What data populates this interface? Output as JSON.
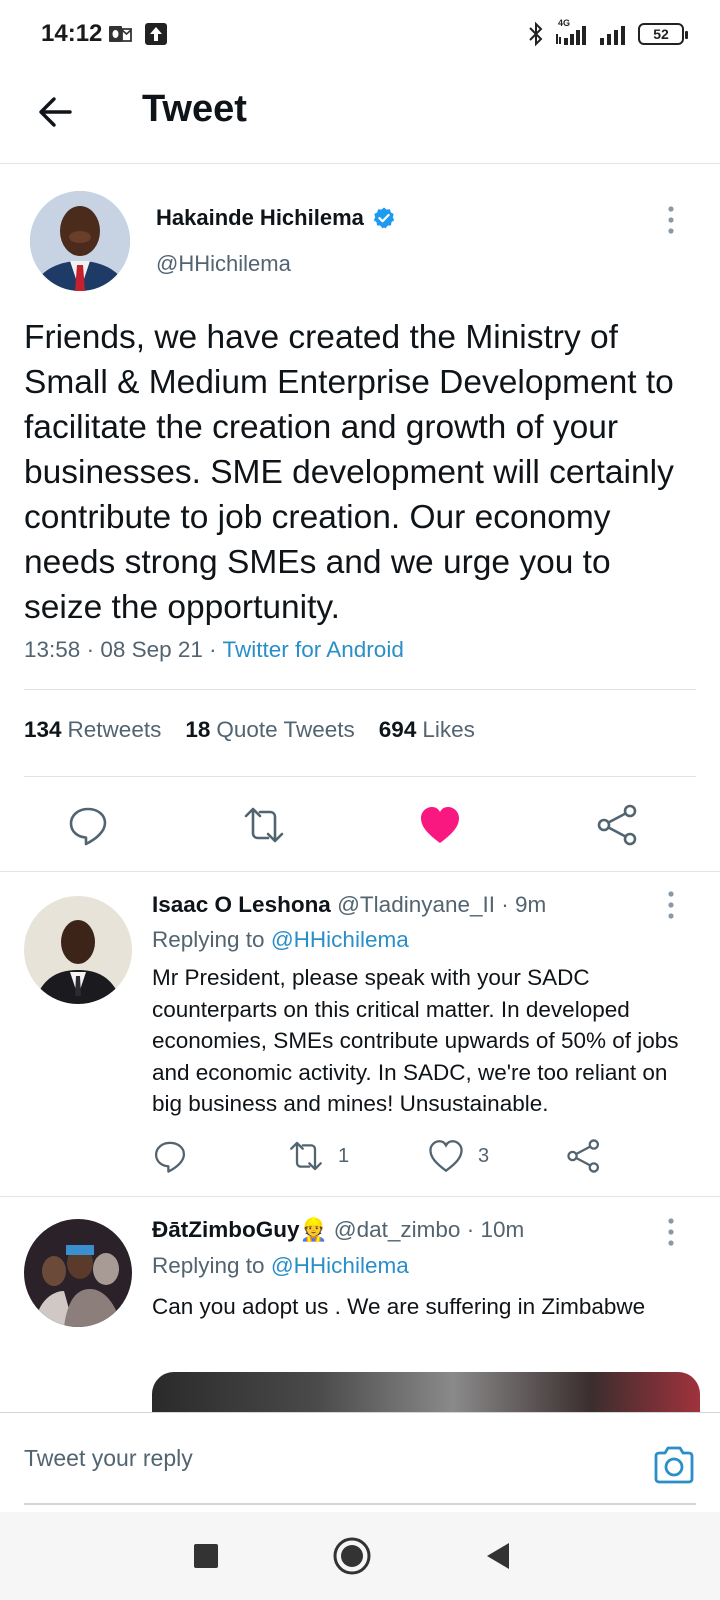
{
  "status_bar": {
    "time": "14:12",
    "network_label": "4G",
    "battery": "52",
    "icons": [
      "outlook-icon",
      "upload-icon",
      "bluetooth-icon",
      "signal-4g-icon",
      "signal-icon",
      "battery-icon"
    ]
  },
  "header": {
    "title": "Tweet",
    "back_icon": "arrow-left-icon"
  },
  "tweet": {
    "author_name": "Hakainde Hichilema",
    "author_handle": "@HHichilema",
    "verified": true,
    "text": "Friends, we have created the Ministry of Small & Medium Enterprise Development to facilitate the creation and growth of your businesses. SME development will certainly contribute to job creation. Our economy needs strong SMEs and we urge you to seize the opportunity.",
    "time": "13:58",
    "date": "08 Sep 21",
    "source": "Twitter for Android",
    "retweets_count": "134",
    "retweets_label": "Retweets",
    "quotes_count": "18",
    "quotes_label": "Quote Tweets",
    "likes_count": "694",
    "likes_label": "Likes",
    "liked": true
  },
  "replies": [
    {
      "name": "Isaac O Leshona",
      "handle": "@Tladinyane_II",
      "age": "9m",
      "replying_prefix": "Replying to",
      "replying_to": "@HHichilema",
      "text": "Mr President, please speak with your SADC counterparts on this critical matter. In developed economies, SMEs contribute upwards of 50% of jobs and economic activity. In SADC, we're too reliant on big business and mines! Unsustainable.",
      "retweets": "1",
      "likes": "3"
    },
    {
      "name": "ĐātZimboGuy",
      "name_emoji": "👷",
      "handle": "@dat_zimbo",
      "age": "10m",
      "replying_prefix": "Replying to",
      "replying_to": "@HHichilema",
      "text": "Can you adopt us . We are suffering in Zimbabwe"
    }
  ],
  "composer": {
    "placeholder": "Tweet your reply",
    "camera_icon": "camera-icon"
  },
  "colors": {
    "link": "#2a8fc9",
    "like": "#f91880",
    "muted": "#536471",
    "text": "#0f1419"
  }
}
